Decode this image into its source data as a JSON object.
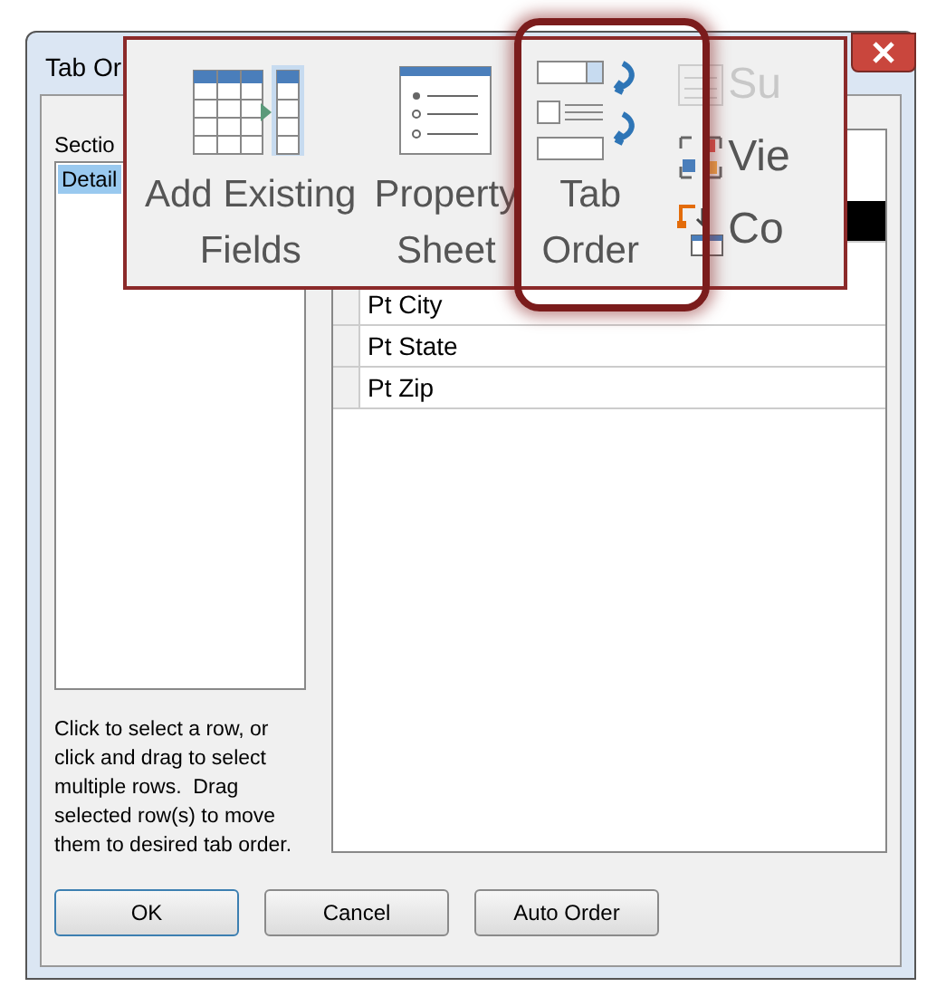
{
  "window": {
    "title": "Tab Or"
  },
  "section_label": "Sectio",
  "sections": [
    {
      "label": "Detail",
      "selected": true
    }
  ],
  "rows": [
    {
      "selected": true
    },
    {
      "label": "Pt City",
      "selected": false
    },
    {
      "label": "Pt State",
      "selected": false
    },
    {
      "label": "Pt Zip",
      "selected": false
    }
  ],
  "help_text": "Click to select a row, or click and drag to select multiple rows.  Drag selected row(s) to move them to desired tab order.",
  "buttons": [
    {
      "label": "OK",
      "default": true
    },
    {
      "label": "Cancel",
      "default": false
    },
    {
      "label": "Auto Order",
      "default": false
    }
  ],
  "ribbon": {
    "large_commands": [
      {
        "kind": "fields",
        "label": "Add Existing\nFields",
        "highlighted": false
      },
      {
        "kind": "sheet",
        "label": "Property\nSheet",
        "highlighted": false
      },
      {
        "kind": "taborder",
        "label": "Tab\nOrder",
        "highlighted": true
      }
    ],
    "small_commands": [
      {
        "kind": "subform",
        "label": "Su",
        "disabled": true
      },
      {
        "kind": "view",
        "label": "Vie",
        "disabled": false
      },
      {
        "kind": "convert",
        "label": "Co",
        "disabled": false
      }
    ]
  }
}
